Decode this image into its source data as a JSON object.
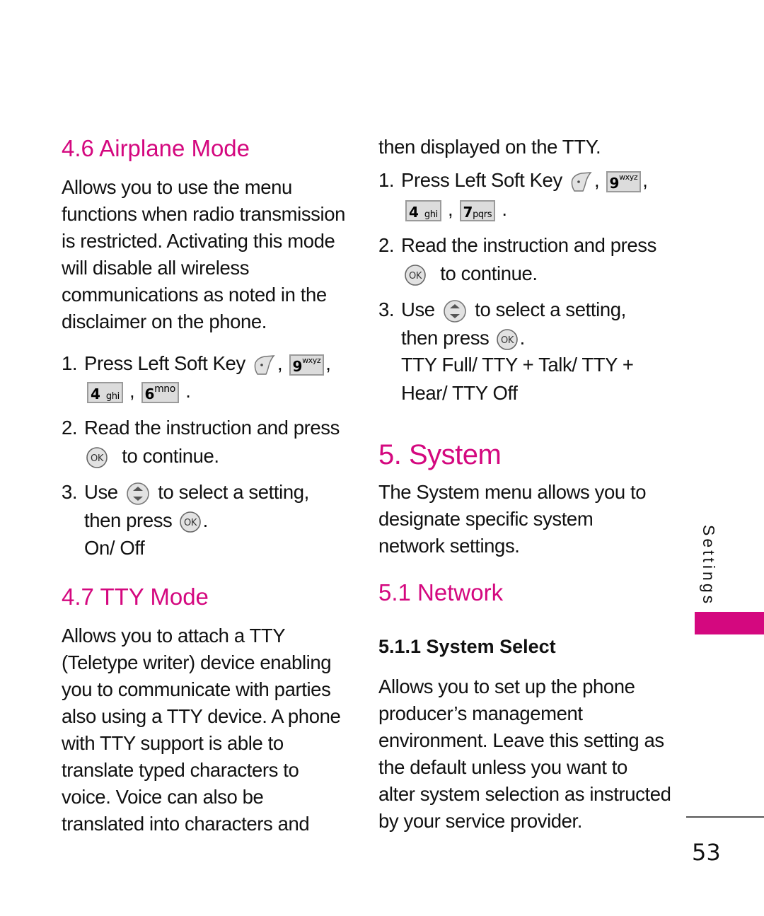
{
  "colors": {
    "accent": "#d4087f",
    "text": "#111111",
    "key_fill": "#dcdcdc",
    "key_border": "#9a9a9a"
  },
  "left": {
    "airplane": {
      "heading": "4.6 Airplane Mode",
      "body": [
        "Allows you to use the menu",
        "functions when radio transmission",
        "is restricted. Activating this mode",
        "will disable all wireless",
        "communications as noted in the",
        "disclaimer on the phone."
      ],
      "step1": {
        "num": "1.",
        "text": "Press Left Soft Key",
        "keys": [
          {
            "icon": "left-soft-key-icon"
          },
          {
            "icon": "key-9-icon",
            "digit": "9",
            "letters": "wxyz"
          },
          {
            "icon": "key-4-icon",
            "digit": "4",
            "letters": "ghi"
          },
          {
            "icon": "key-6-icon",
            "digit": "6",
            "letters": "mno"
          }
        ]
      },
      "step2": {
        "num": "2.",
        "text": "Read the instruction and press",
        "cont": "to continue."
      },
      "step3": {
        "num": "3.",
        "text_pre": "Use",
        "text_post": "to select a setting,",
        "then": "then press",
        "options": "On/ Off"
      },
      "sep_comma": ",",
      "sep_period": "."
    },
    "tty": {
      "heading": "4.7 TTY Mode",
      "body": [
        "Allows you to attach a TTY",
        "(Teletype writer) device enabling",
        "you to communicate with parties",
        "also using a TTY device. A phone",
        "with TTY support is able to",
        "translate typed characters to",
        "voice. Voice can also be",
        "translated into characters and"
      ]
    }
  },
  "right": {
    "tty_cont": "then displayed on the TTY.",
    "step1": {
      "num": "1.",
      "text": "Press Left Soft Key",
      "keys": [
        {
          "icon": "left-soft-key-icon"
        },
        {
          "icon": "key-9-icon",
          "digit": "9",
          "letters": "wxyz"
        },
        {
          "icon": "key-4-icon",
          "digit": "4",
          "letters": "ghi"
        },
        {
          "icon": "key-7-icon",
          "digit": "7",
          "letters": "pqrs"
        }
      ]
    },
    "step2": {
      "num": "2.",
      "text": "Read the instruction and press",
      "cont": "to continue."
    },
    "step3": {
      "num": "3.",
      "text_pre": "Use",
      "text_post": "to select a setting,",
      "then": "then press",
      "options": [
        "TTY Full/ TTY + Talk/ TTY +",
        "Hear/ TTY Off"
      ]
    },
    "system": {
      "heading": "5. System",
      "body": [
        "The System menu allows you to",
        "designate specific system",
        "network settings."
      ]
    },
    "network": {
      "heading": "5.1 Network"
    },
    "system_select": {
      "heading": "5.1.1 System Select",
      "body": [
        "Allows you to set up the phone",
        "producer’s management",
        "environment. Leave this setting as",
        "the default unless you want to",
        "alter system selection as instructed",
        "by your service provider."
      ]
    }
  },
  "side_tab": {
    "label": "Settings"
  },
  "page_number": "53"
}
